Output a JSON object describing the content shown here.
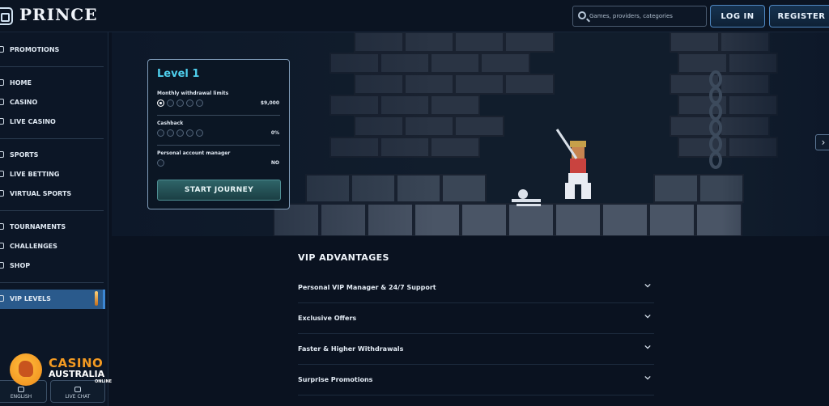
{
  "header": {
    "logo": "PRINCE",
    "search_placeholder": "Games, providers, categories",
    "login": "LOG IN",
    "register": "REGISTER"
  },
  "sidebar": {
    "items": [
      {
        "label": "PROMOTIONS",
        "icon": "gift-icon"
      },
      {
        "label": "HOME",
        "icon": "home-icon"
      },
      {
        "label": "CASINO",
        "icon": "cards-icon"
      },
      {
        "label": "LIVE CASINO",
        "icon": "chip-icon"
      },
      {
        "label": "SPORTS",
        "icon": "ball-icon"
      },
      {
        "label": "LIVE BETTING",
        "icon": "live-icon"
      },
      {
        "label": "VIRTUAL SPORTS",
        "icon": "gamepad-icon"
      },
      {
        "label": "TOURNAMENTS",
        "icon": "trophy-icon"
      },
      {
        "label": "CHALLENGES",
        "icon": "swords-icon"
      },
      {
        "label": "SHOP",
        "icon": "bag-icon"
      },
      {
        "label": "VIP LEVELS",
        "icon": "crown-icon",
        "active": true
      }
    ],
    "english": "ENGLISH",
    "live_chat": "LIVE CHAT"
  },
  "level_card": {
    "title": "Level 1",
    "monthly_label": "Monthly withdrawal limits",
    "monthly_value": "$9,000",
    "monthly_filled": 1,
    "monthly_total": 5,
    "cashback_label": "Cashback",
    "cashback_value": "0%",
    "cashback_filled": 0,
    "cashback_total": 5,
    "manager_label": "Personal account manager",
    "manager_value": "NO",
    "manager_filled": 0,
    "manager_total": 1,
    "cta": "START JOURNEY"
  },
  "vip": {
    "title": "VIP ADVANTAGES",
    "items": [
      "Personal VIP Manager & 24/7 Support",
      "Exclusive Offers",
      "Faster & Higher Withdrawals",
      "Surprise Promotions"
    ]
  },
  "watermark": {
    "title": "CASINO",
    "sub": "AUSTRALIA",
    "online": "ONLINE"
  },
  "colors": {
    "accent": "#4fd0ee",
    "active_nav": "#2a5a8c",
    "cta": "#2e6468",
    "badge_orange": "#f39a22"
  }
}
